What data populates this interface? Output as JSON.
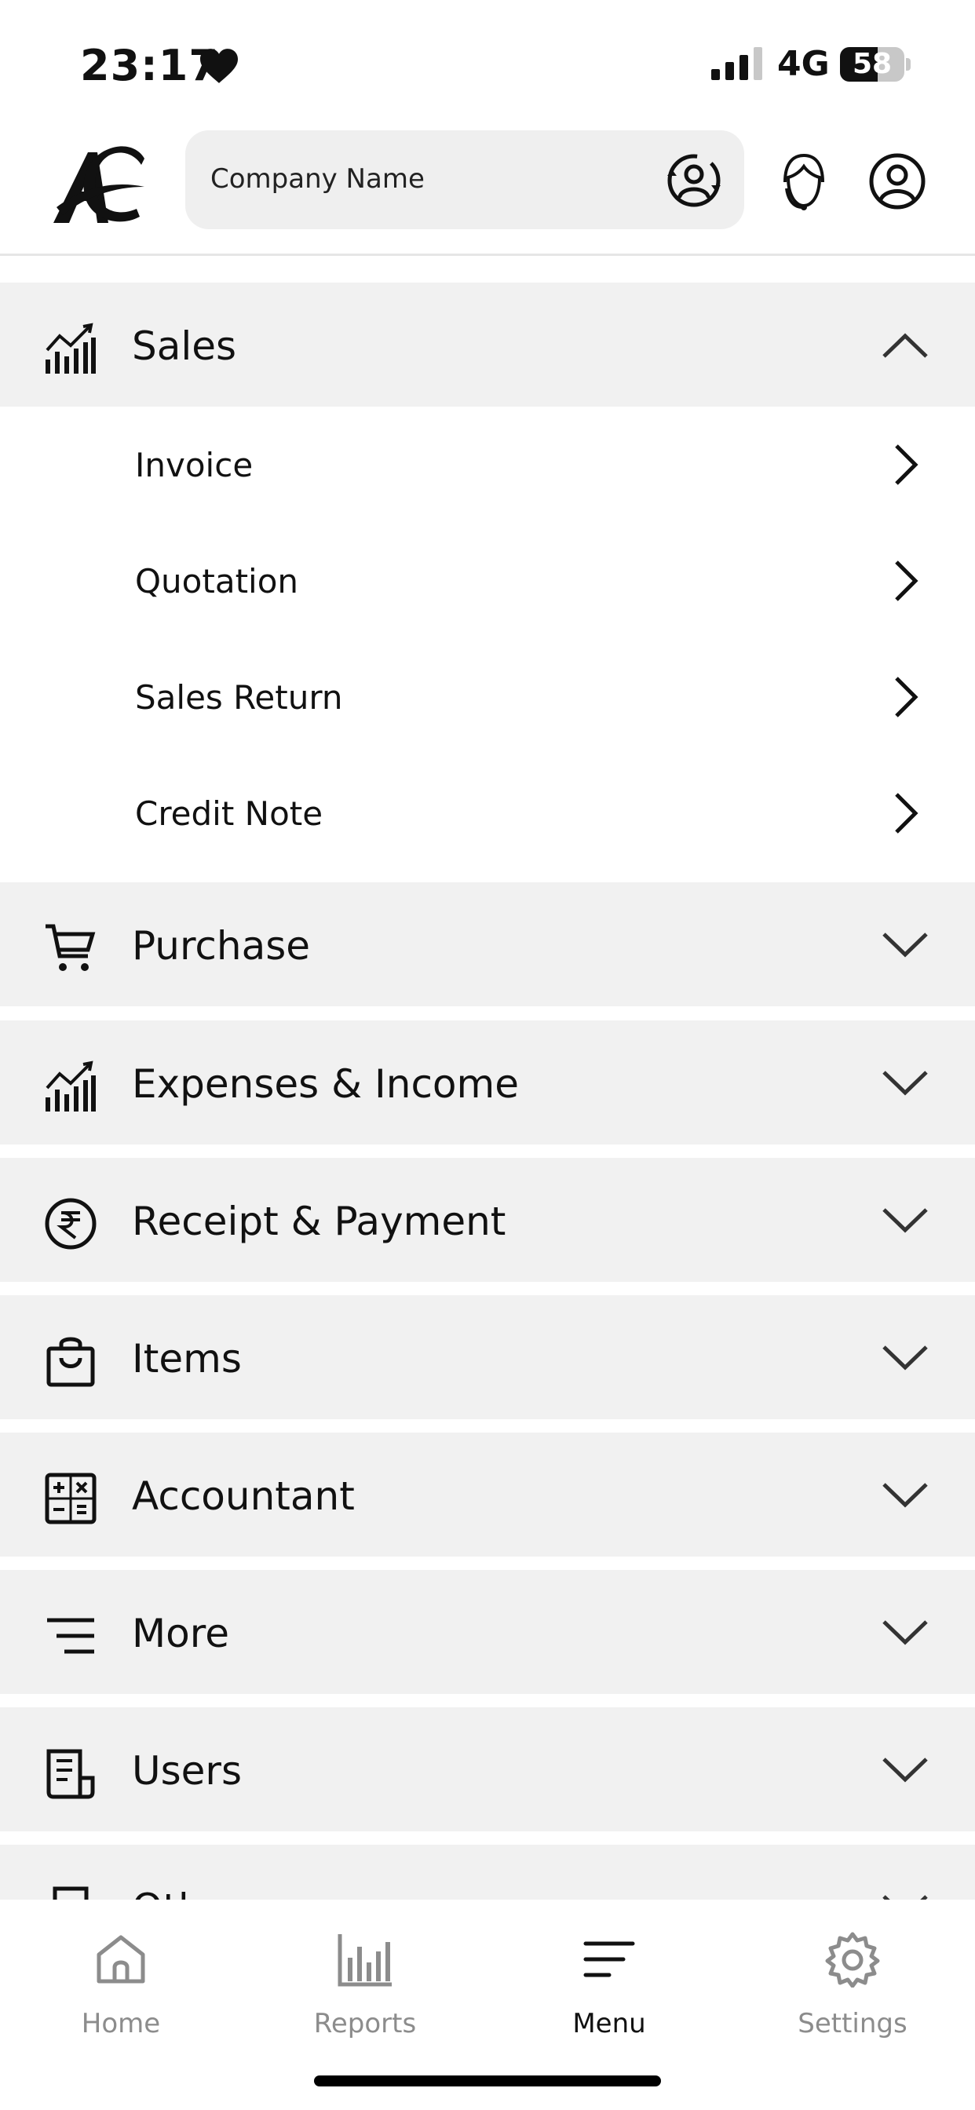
{
  "status_bar": {
    "time": "23:17",
    "network": "4G",
    "battery": "58",
    "battery_percent": 58
  },
  "header": {
    "search_placeholder": "Company Name"
  },
  "menu": {
    "sections": [
      {
        "label": "Sales",
        "icon": "chart-icon",
        "expanded": true
      },
      {
        "label": "Purchase",
        "icon": "cart-icon",
        "expanded": false
      },
      {
        "label": "Expenses & Income",
        "icon": "chart-icon",
        "expanded": false
      },
      {
        "label": "Receipt & Payment",
        "icon": "rupee-icon",
        "expanded": false
      },
      {
        "label": "Items",
        "icon": "bag-icon",
        "expanded": false
      },
      {
        "label": "Accountant",
        "icon": "calculator-icon",
        "expanded": false
      },
      {
        "label": "More",
        "icon": "menu-lines-icon",
        "expanded": false
      },
      {
        "label": "Users",
        "icon": "document-icon",
        "expanded": false
      },
      {
        "label": "Oth",
        "icon": "printer-icon",
        "expanded": false
      }
    ],
    "sales_items": [
      {
        "label": "Invoice"
      },
      {
        "label": "Quotation"
      },
      {
        "label": "Sales Return"
      },
      {
        "label": "Credit Note"
      }
    ]
  },
  "tabs": [
    {
      "label": "Home",
      "icon": "home-icon",
      "active": false
    },
    {
      "label": "Reports",
      "icon": "bar-chart-icon",
      "active": false
    },
    {
      "label": "Menu",
      "icon": "menu-icon",
      "active": true
    },
    {
      "label": "Settings",
      "icon": "gear-icon",
      "active": false
    }
  ]
}
